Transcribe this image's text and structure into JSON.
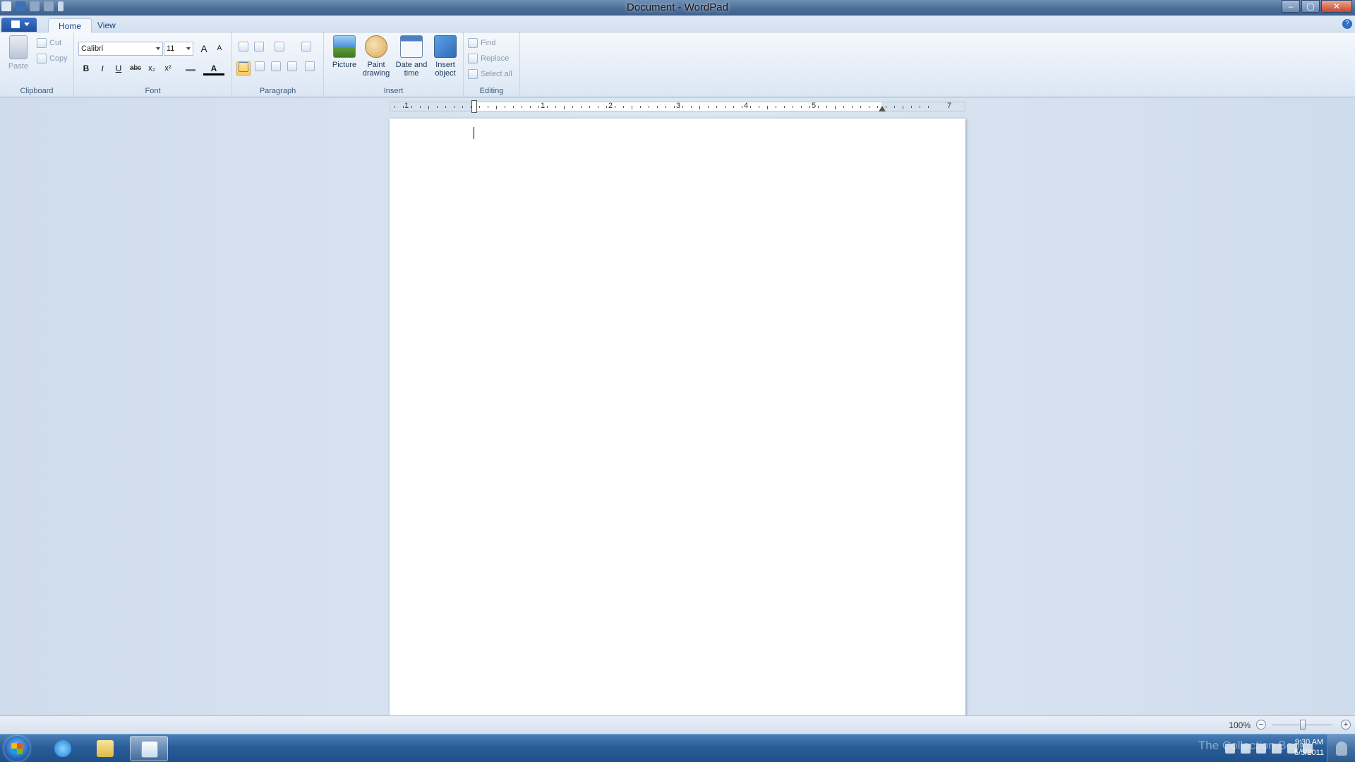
{
  "window": {
    "title": "Document - WordPad"
  },
  "title_buttons": {
    "minimize": "‒",
    "maximize": "▢",
    "close": "✕"
  },
  "ribbon_tabs": [
    {
      "label": "Home",
      "active": true
    },
    {
      "label": "View",
      "active": false
    }
  ],
  "help_label": "?",
  "clipboard": {
    "group_label": "Clipboard",
    "paste_label": "Paste",
    "cut_label": "Cut",
    "copy_label": "Copy"
  },
  "font": {
    "group_label": "Font",
    "family_value": "Calibri",
    "size_value": "11",
    "grow_label": "A",
    "shrink_label": "A",
    "bold_label": "B",
    "italic_label": "I",
    "underline_label": "U",
    "strike_label": "abc",
    "subscript_label": "x₂",
    "superscript_label": "x²",
    "color_label": "A"
  },
  "paragraph": {
    "group_label": "Paragraph"
  },
  "insert": {
    "group_label": "Insert",
    "picture_label": "Picture",
    "paint_label_1": "Paint",
    "paint_label_2": "drawing",
    "datetime_label_1": "Date and",
    "datetime_label_2": "time",
    "object_label_1": "Insert",
    "object_label_2": "object"
  },
  "editing": {
    "group_label": "Editing",
    "find_label": "Find",
    "replace_label": "Replace",
    "select_all_label": "Select all"
  },
  "ruler": {
    "numbers": [
      "1",
      "1",
      "2",
      "3",
      "4",
      "5",
      "7"
    ]
  },
  "status": {
    "zoom": "100%",
    "zoom_out": "−",
    "zoom_in": "+"
  },
  "taskbar": {
    "time": "9:30 AM",
    "date": "5/5/2011",
    "watermark": "The Collection Book"
  },
  "colors": {
    "accent": "#2a5e98",
    "ribbon": "#e3ecf7",
    "workspace": "#d3dfee"
  }
}
